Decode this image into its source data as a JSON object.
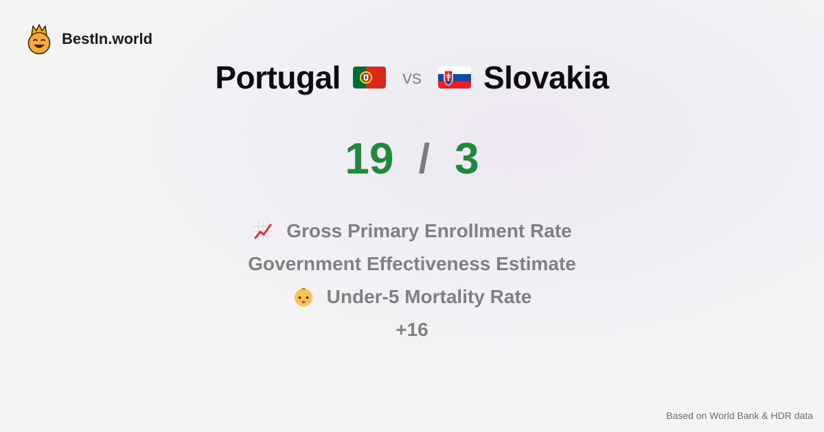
{
  "brand": {
    "name": "BestIn.world",
    "icon": "crowned-smiley-icon"
  },
  "comparison": {
    "country_a": {
      "name": "Portugal",
      "flag": "portugal-flag-icon",
      "score": "19"
    },
    "vs_label": "vs",
    "country_b": {
      "name": "Slovakia",
      "flag": "slovakia-flag-icon",
      "score": "3"
    },
    "separator": "/"
  },
  "metrics": [
    {
      "label": "Gross Primary Enrollment Rate",
      "icon": "chart-increasing-icon"
    },
    {
      "label": "Government Effectiveness Estimate",
      "icon": ""
    },
    {
      "label": "Under-5 Mortality Rate",
      "icon": "baby-face-icon"
    }
  ],
  "more_label": "+16",
  "footer": "Based on World Bank & HDR data",
  "colors": {
    "score": "#1f8a3c",
    "muted": "#808080",
    "separator": "#7c7c7c"
  }
}
